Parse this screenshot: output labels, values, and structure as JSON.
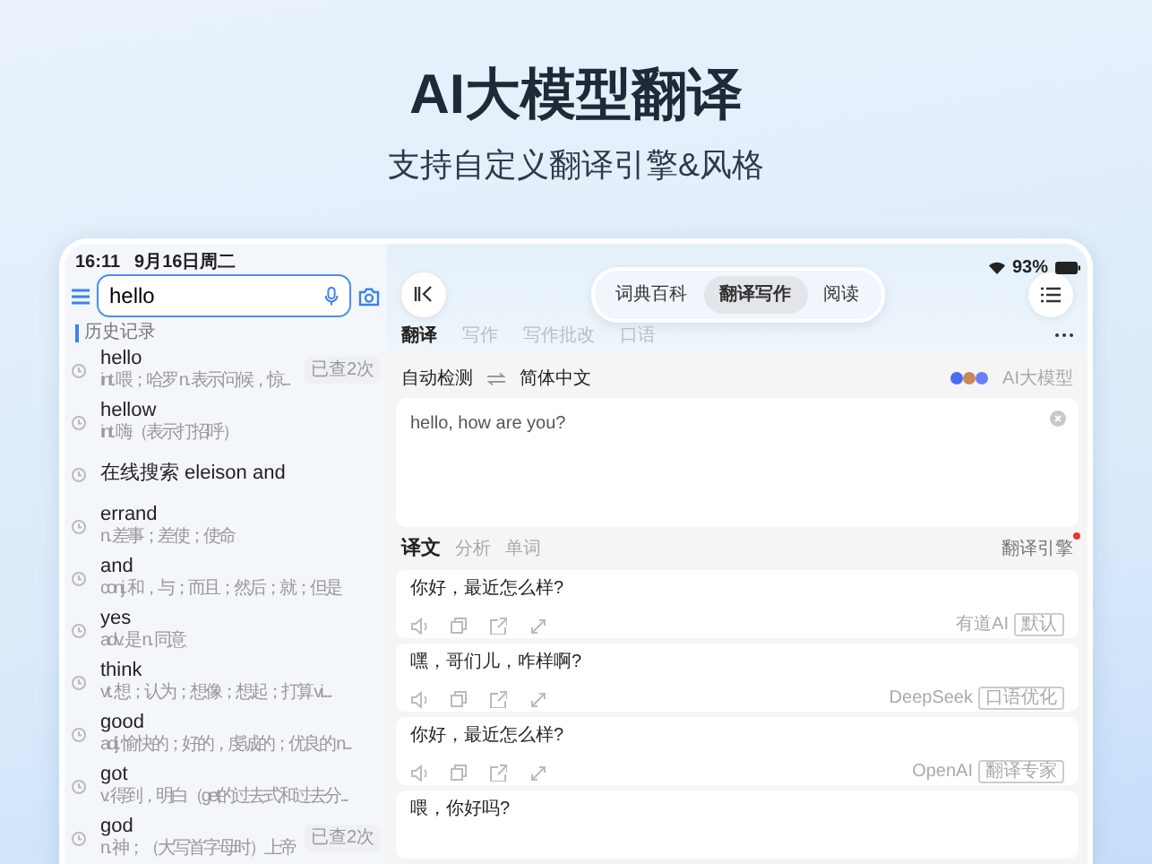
{
  "headline": "AI大模型翻译",
  "subheadline": "支持自定义翻译引擎&风格",
  "status_bar": {
    "time": "16:11",
    "date": "9月16日周二",
    "battery": "93%"
  },
  "sidebar": {
    "search": {
      "value": "hello"
    },
    "section_title": "历史记录",
    "items": [
      {
        "word": "hello",
        "definition": "int. 喂；哈罗 n. 表示问候，惊...",
        "count": "已查2次"
      },
      {
        "word": "hellow",
        "definition": "int. 嗨（表示打招呼）"
      },
      {
        "word": "在线搜索 eleison and"
      },
      {
        "word": "errand",
        "definition": "n. 差事；差使；使命"
      },
      {
        "word": "and",
        "definition": "conj. 和，与；而且；然后；就；但是"
      },
      {
        "word": "yes",
        "definition": "adv. 是 n. 同意"
      },
      {
        "word": "think",
        "definition": "vt. 想；认为；想像；想起；打算 vi...."
      },
      {
        "word": "good",
        "definition": "adj. 愉快的；好的，虔诚的；优良的 n..."
      },
      {
        "word": "got",
        "definition": "v. 得到，明白（get的过去式和过去分..."
      },
      {
        "word": "god",
        "definition": "n. 神；（大写首字母时）上帝",
        "count": "已查2次"
      }
    ]
  },
  "mode_switch": [
    {
      "label": "词典百科",
      "selected": false
    },
    {
      "label": "翻译写作",
      "selected": true
    },
    {
      "label": "阅读",
      "selected": false
    }
  ],
  "tabs": [
    {
      "label": "翻译",
      "selected": true
    },
    {
      "label": "写作",
      "selected": false
    },
    {
      "label": "写作批改",
      "selected": false
    },
    {
      "label": "口语",
      "selected": false
    }
  ],
  "language_bar": {
    "source": "自动检测",
    "target": "简体中文",
    "engine_label": "AI大模型"
  },
  "input": {
    "value": "hello, how are you?"
  },
  "result_tabs": [
    {
      "label": "译文",
      "selected": true
    },
    {
      "label": "分析",
      "selected": false
    },
    {
      "label": "单词",
      "selected": false
    }
  ],
  "engine_link": {
    "label": "翻译引擎",
    "has_notification": true
  },
  "results": [
    {
      "text": "你好，最近怎么样?",
      "engine": "有道AI",
      "tag": "默认"
    },
    {
      "text": "嘿，哥们儿，咋样啊?",
      "engine": "DeepSeek",
      "tag": "口语优化"
    },
    {
      "text": "你好，最近怎么样?",
      "engine": "OpenAI",
      "tag": "翻译专家"
    },
    {
      "text": "喂，你好吗?"
    }
  ]
}
